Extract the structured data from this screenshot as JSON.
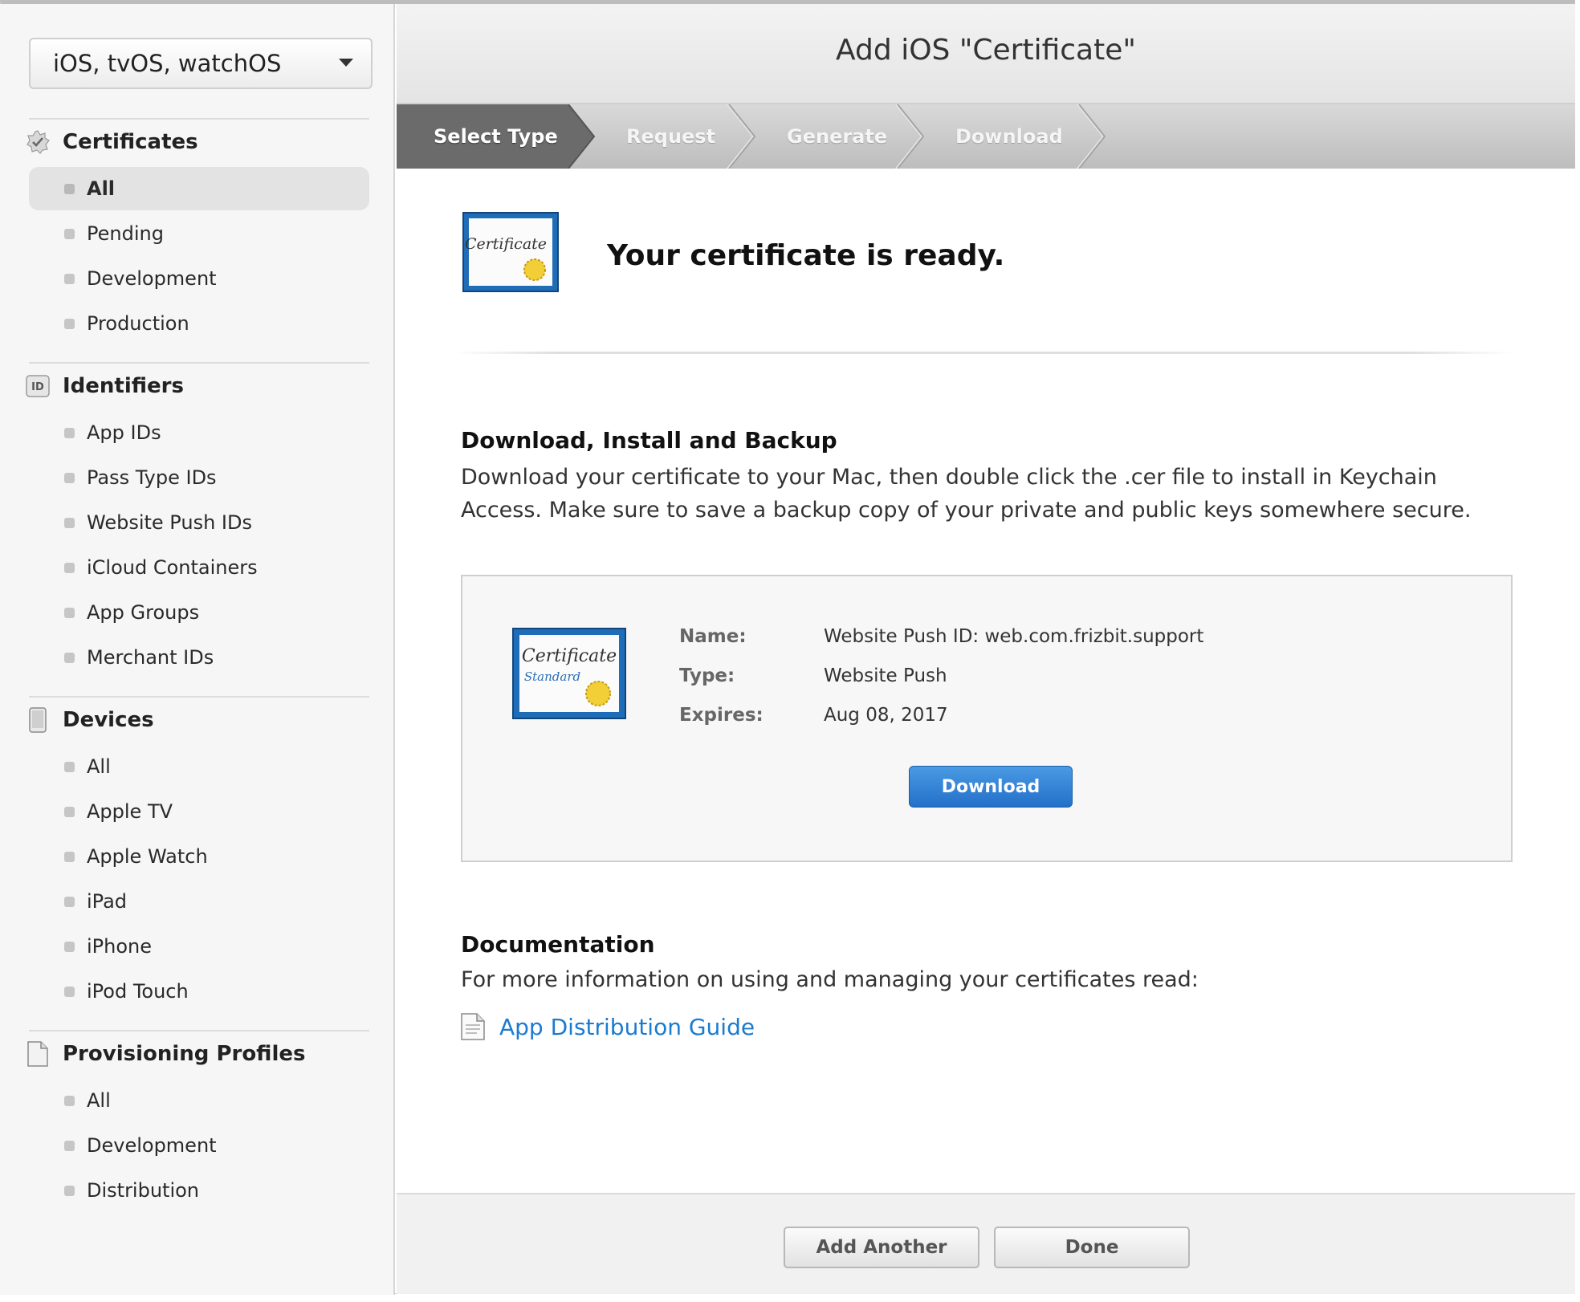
{
  "sidebar": {
    "platform": "iOS, tvOS, watchOS",
    "sections": {
      "certificates": {
        "title": "Certificates",
        "items": [
          "All",
          "Pending",
          "Development",
          "Production"
        ]
      },
      "identifiers": {
        "title": "Identifiers",
        "icon_text": "ID",
        "items": [
          "App IDs",
          "Pass Type IDs",
          "Website Push IDs",
          "iCloud Containers",
          "App Groups",
          "Merchant IDs"
        ]
      },
      "devices": {
        "title": "Devices",
        "items": [
          "All",
          "Apple TV",
          "Apple Watch",
          "iPad",
          "iPhone",
          "iPod Touch"
        ]
      },
      "profiles": {
        "title": "Provisioning Profiles",
        "items": [
          "All",
          "Development",
          "Distribution"
        ]
      }
    }
  },
  "header": {
    "title": "Add iOS \"Certificate\""
  },
  "steps": [
    "Select Type",
    "Request",
    "Generate",
    "Download"
  ],
  "main": {
    "ready_title": "Your certificate is ready.",
    "cert_icon_text": "Certificate",
    "cert_icon_subtext": "Standard",
    "install_heading": "Download, Install and Backup",
    "install_text_1": "Download your certificate to your Mac, then double click the .cer file to install in Keychain",
    "install_text_2": "Access. Make sure to save a backup copy of your private and public keys somewhere secure.",
    "certificate": {
      "name_label": "Name:",
      "name_value": "Website Push ID: web.com.frizbit.support",
      "type_label": "Type:",
      "type_value": "Website Push",
      "expires_label": "Expires:",
      "expires_value": "Aug 08, 2017",
      "download_label": "Download"
    },
    "doc_heading": "Documentation",
    "doc_text": "For more information on using and managing your certificates read:",
    "doc_link": "App Distribution Guide"
  },
  "footer": {
    "add_another": "Add Another",
    "done": "Done"
  },
  "colors": {
    "link": "#1a7bd0",
    "primary_button": "#2370c9",
    "active_step": "#6e6e6e"
  }
}
